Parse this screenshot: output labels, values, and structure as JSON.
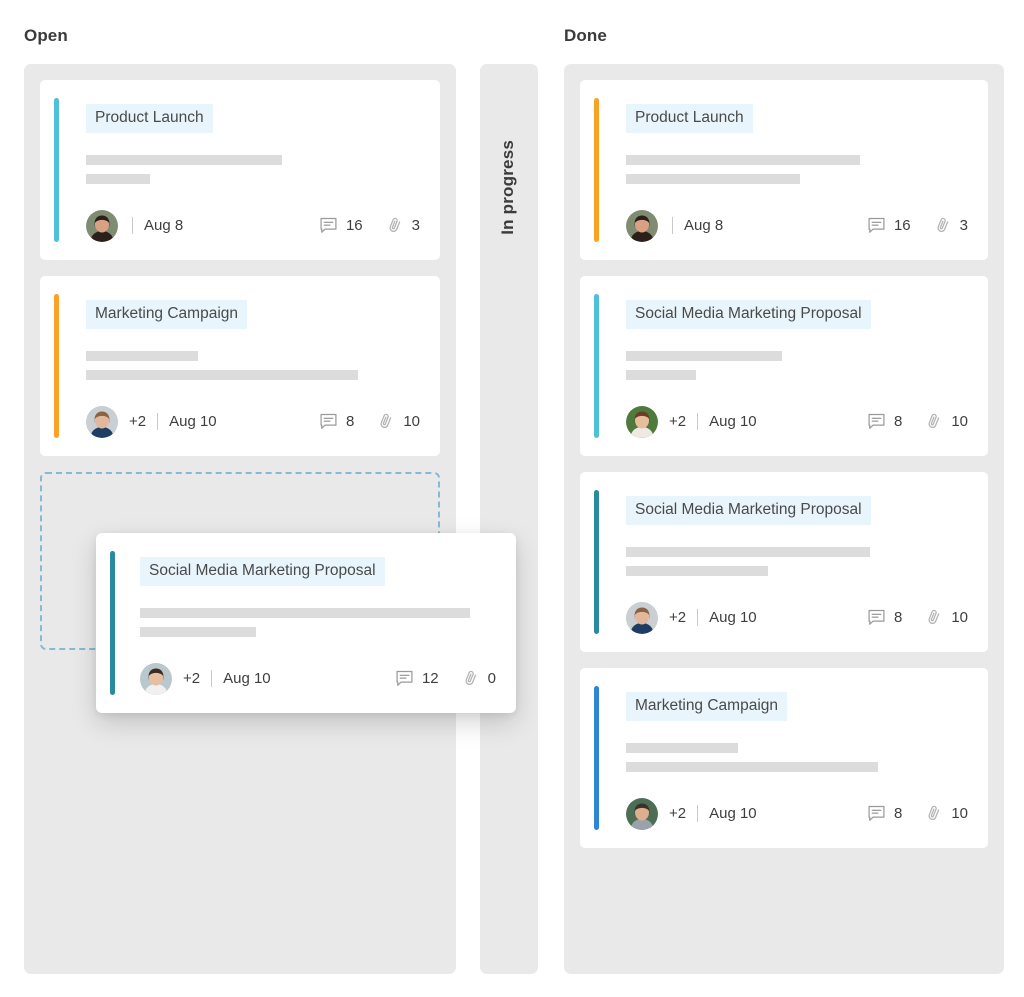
{
  "board": {
    "columns": [
      {
        "id": "open",
        "title": "Open",
        "collapsed": false
      },
      {
        "id": "inprogress",
        "title": "In progress",
        "collapsed": true
      },
      {
        "id": "done",
        "title": "Done",
        "collapsed": false
      }
    ]
  },
  "colors": {
    "accent_cyan": "#4fc0d9",
    "accent_orange": "#f9a226",
    "accent_teal": "#2a8a9e",
    "accent_blue": "#2e86d4",
    "title_highlight": "#e9f5fc",
    "column_bg": "#e9e9e9",
    "card_bg": "#ffffff",
    "skeleton": "#dcdcdc",
    "dropzone_border": "#86bad2",
    "text": "#3f3f3f"
  },
  "icons": {
    "comment": "comment-icon",
    "attachment": "paperclip-icon",
    "avatar": "avatar-icon"
  },
  "open_cards": [
    {
      "title": "Product Launch",
      "accent": "#4fc0d9",
      "skeleton_widths": [
        "196px",
        "64px"
      ],
      "extra_count": "",
      "date": "Aug 8",
      "comments": "16",
      "attachments": "3",
      "avatar_hair": "#2b2019",
      "avatar_skin": "#d8a184",
      "avatar_bg": "#7f8c72",
      "avatar_shirt": "#2b2019"
    },
    {
      "title": "Marketing Campaign",
      "accent": "#f9a226",
      "skeleton_widths": [
        "112px",
        "272px"
      ],
      "extra_count": "+2",
      "date": "Aug 10",
      "comments": "8",
      "attachments": "10",
      "avatar_hair": "#8a6343",
      "avatar_skin": "#e3b79b",
      "avatar_bg": "#c9cfd2",
      "avatar_shirt": "#1d3d63"
    }
  ],
  "open_dropzone": {
    "label": "drop-placeholder"
  },
  "dragged_card": {
    "title": "Social Media Marketing Proposal",
    "accent": "#2a8a9e",
    "skeleton_widths": [
      "330px",
      "116px"
    ],
    "extra_count": "+2",
    "date": "Aug 10",
    "comments": "12",
    "attachments": "0",
    "avatar_hair": "#3d2b21",
    "avatar_skin": "#e6bfa2",
    "avatar_bg": "#b9c8cd",
    "avatar_shirt": "#f2f0ee"
  },
  "done_cards": [
    {
      "title": "Product Launch",
      "accent": "#f9a226",
      "skeleton_widths": [
        "234px",
        "174px"
      ],
      "extra_count": "",
      "date": "Aug 8",
      "comments": "16",
      "attachments": "3",
      "avatar_hair": "#2b2019",
      "avatar_skin": "#d8a184",
      "avatar_bg": "#7f8c72",
      "avatar_shirt": "#2b2019"
    },
    {
      "title": "Social Media Marketing Proposal",
      "accent": "#4fc0d9",
      "skeleton_widths": [
        "156px",
        "70px"
      ],
      "extra_count": "+2",
      "date": "Aug 10",
      "comments": "8",
      "attachments": "10",
      "avatar_hair": "#6b3d22",
      "avatar_skin": "#e8bd9c",
      "avatar_bg": "#4e7a3d",
      "avatar_shirt": "#efe9e4"
    },
    {
      "title": "Social Media Marketing Proposal",
      "accent": "#2a8a9e",
      "skeleton_widths": [
        "244px",
        "142px"
      ],
      "extra_count": "+2",
      "date": "Aug 10",
      "comments": "8",
      "attachments": "10",
      "avatar_hair": "#8a6343",
      "avatar_skin": "#e3b79b",
      "avatar_bg": "#c9cfd2",
      "avatar_shirt": "#1d3d63"
    },
    {
      "title": "Marketing Campaign",
      "accent": "#2e86d4",
      "skeleton_widths": [
        "112px",
        "252px"
      ],
      "extra_count": "+2",
      "date": "Aug 10",
      "comments": "8",
      "attachments": "10",
      "avatar_hair": "#3b3128",
      "avatar_skin": "#dcaf8e",
      "avatar_bg": "#4d6d55",
      "avatar_shirt": "#9aa2ac"
    }
  ]
}
